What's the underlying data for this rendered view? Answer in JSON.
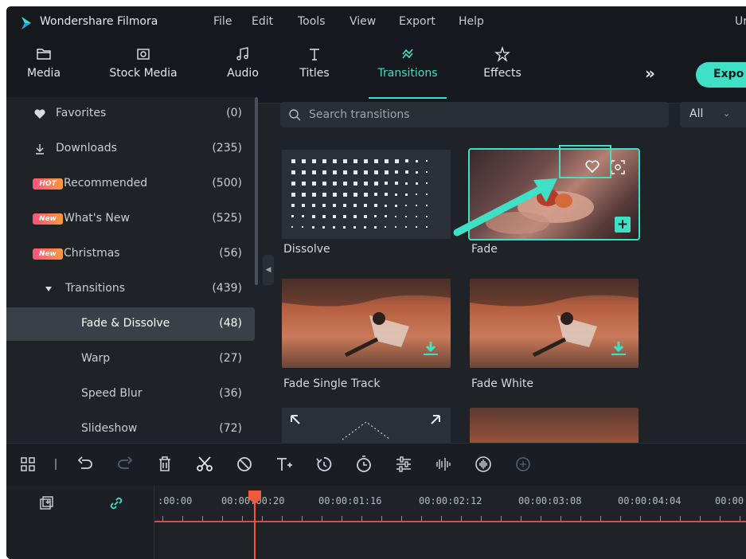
{
  "titlebar": {
    "app_name": "Wondershare Filmora",
    "menu": [
      "File",
      "Edit",
      "Tools",
      "View",
      "Export",
      "Help"
    ],
    "right_text": "Ur"
  },
  "toolbar": {
    "tabs": [
      {
        "label": "Media",
        "icon": "folder-icon"
      },
      {
        "label": "Stock Media",
        "icon": "stock-media-icon"
      },
      {
        "label": "Audio",
        "icon": "music-icon"
      },
      {
        "label": "Titles",
        "icon": "text-icon"
      },
      {
        "label": "Transitions",
        "icon": "transitions-icon",
        "active": true
      },
      {
        "label": "Effects",
        "icon": "effects-icon"
      }
    ],
    "more_label": "»",
    "export_label": "Expo"
  },
  "sidebar": {
    "items": [
      {
        "label": "Favorites",
        "count": "(0)",
        "icon": "heart-icon"
      },
      {
        "label": "Downloads",
        "count": "(235)",
        "icon": "download-icon"
      },
      {
        "label": "Recommended",
        "count": "(500)",
        "badge": "HOT"
      },
      {
        "label": "What's New",
        "count": "(525)",
        "badge": "New"
      },
      {
        "label": "Christmas",
        "count": "(56)",
        "badge": "New"
      },
      {
        "label": "Transitions",
        "count": "(439)",
        "icon": "triangle-down-icon"
      },
      {
        "label": "Fade & Dissolve",
        "count": "(48)",
        "selected": true
      },
      {
        "label": "Warp",
        "count": "(27)"
      },
      {
        "label": "Speed Blur",
        "count": "(36)"
      },
      {
        "label": "Slideshow",
        "count": "(72)"
      }
    ]
  },
  "search": {
    "placeholder": "Search transitions",
    "filter_value": "All"
  },
  "cards": [
    {
      "label": "Dissolve"
    },
    {
      "label": "Fade",
      "selected": true
    },
    {
      "label": "Fade Single Track"
    },
    {
      "label": "Fade White"
    },
    {
      "label": ""
    },
    {
      "label": ""
    }
  ],
  "timeline": {
    "ruler_labels": [
      ":00:00",
      "00:00:00:20",
      "00:00:01:16",
      "00:00:02:12",
      "00:00:03:08",
      "00:00:04:04",
      "00:00"
    ],
    "accent": "#3ee0c6",
    "playhead_color": "#ef5a3c"
  }
}
